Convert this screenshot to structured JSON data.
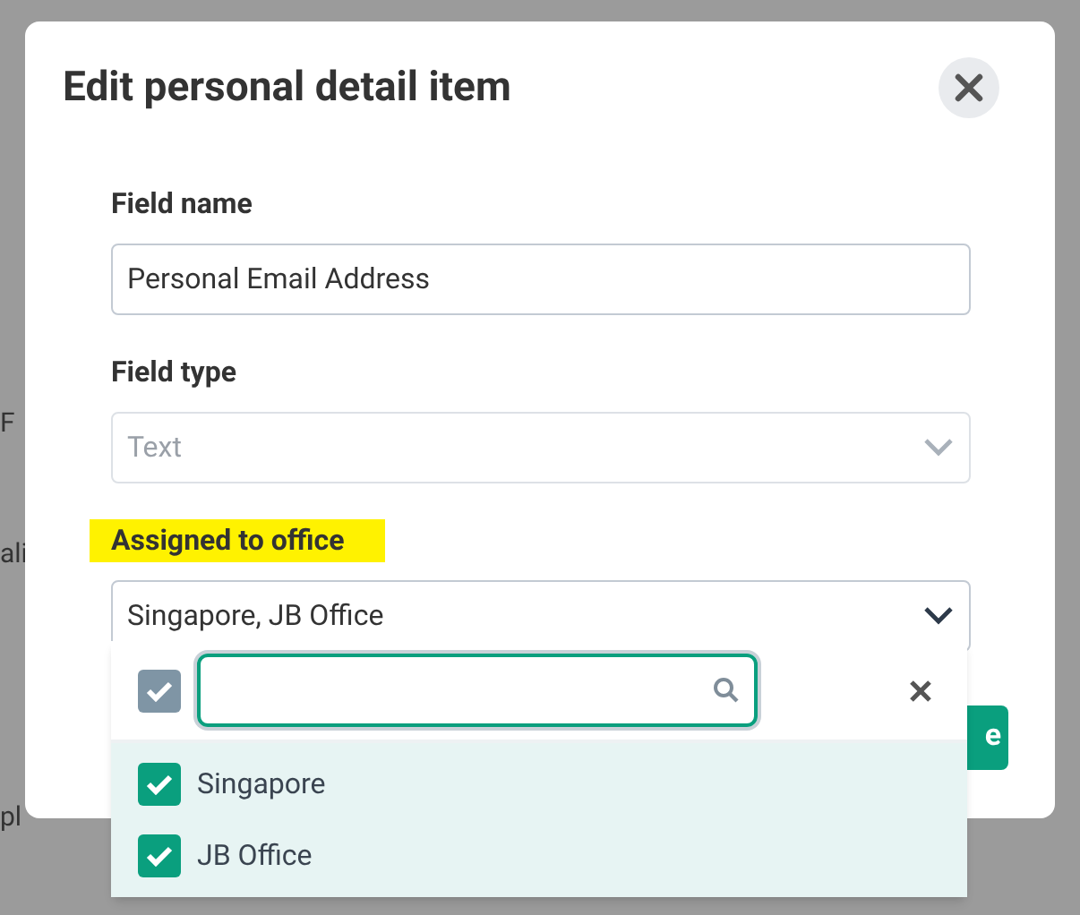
{
  "background": {
    "row_labels": [
      "F",
      "ali",
      "pl"
    ]
  },
  "dialog": {
    "title": "Edit personal detail item",
    "fields": [
      {
        "kind": "text",
        "label": "Field name",
        "value": "Personal Email Address",
        "disabled": false,
        "highlighted": false
      },
      {
        "kind": "select",
        "label": "Field type",
        "value": "Text",
        "disabled": true,
        "highlighted": false
      },
      {
        "kind": "select",
        "label": "Assigned to office",
        "value": "Singapore, JB Office",
        "disabled": false,
        "highlighted": true
      }
    ],
    "save_button": {
      "label": "e"
    }
  },
  "dropdown": {
    "select_all": {
      "checked": true
    },
    "options": [
      {
        "label": "Singapore",
        "checked": true
      },
      {
        "label": "JB Office",
        "checked": true
      }
    ]
  }
}
